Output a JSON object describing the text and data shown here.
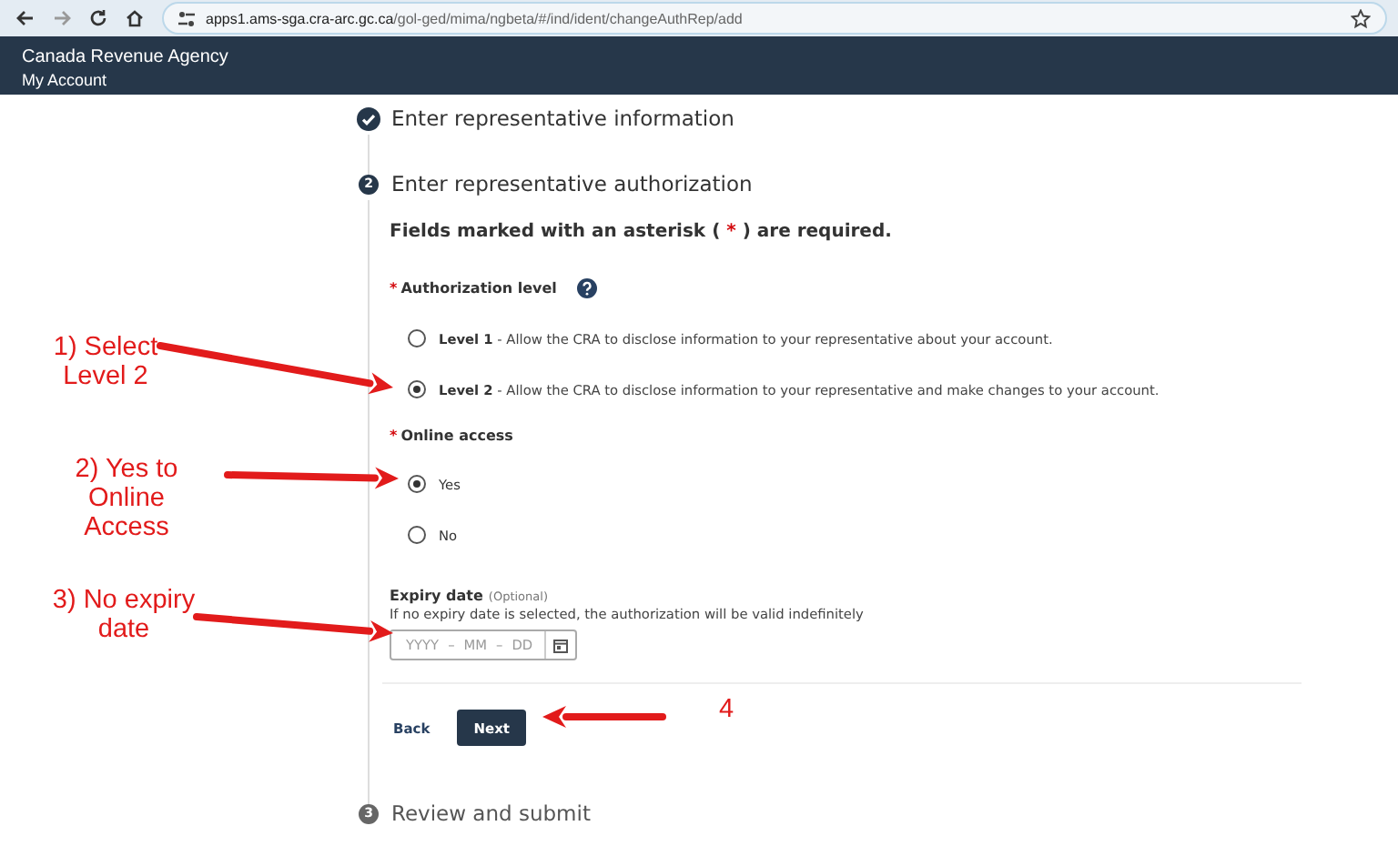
{
  "browser": {
    "url_host": "apps1.ams-sga.cra-arc.gc.ca",
    "url_path": "/gol-ged/mima/ngbeta/#/ind/ident/changeAuthRep/add"
  },
  "header": {
    "title": "Canada Revenue Agency",
    "subtitle": "My Account"
  },
  "steps": [
    {
      "completed": true,
      "current": false,
      "title": "Enter representative information"
    },
    {
      "completed": false,
      "current": true,
      "number": "2",
      "title": "Enter representative authorization"
    },
    {
      "completed": false,
      "current": false,
      "number": "3",
      "title": "Review and submit"
    }
  ],
  "form": {
    "required_note": {
      "before": "Fields marked with an asterisk (",
      "marker": "*",
      "after": ") are required."
    },
    "authorization_level": {
      "label": "Authorization level",
      "required": true,
      "help": true,
      "options": [
        {
          "label": "Level 1",
          "description": "- Allow the CRA to disclose information to your representative about your account.",
          "selected": false
        },
        {
          "label": "Level 2",
          "description": "- Allow the CRA to disclose information to your representative and make changes to your account.",
          "selected": true
        }
      ]
    },
    "online_access": {
      "label": "Online access",
      "required": true,
      "options": [
        {
          "label": "Yes",
          "selected": true
        },
        {
          "label": "No",
          "selected": false
        }
      ]
    },
    "expiry_date": {
      "label": "Expiry date",
      "optional_tag": "(Optional)",
      "hint": "If no expiry date is selected, the authorization will be valid indefinitely",
      "placeholders": [
        "YYYY",
        "MM",
        "DD"
      ],
      "separator": "–"
    },
    "buttons": [
      {
        "kind": "link",
        "label": "Back"
      },
      {
        "kind": "primary",
        "label": "Next"
      }
    ]
  },
  "annotations": [
    {
      "text": "1) Select\nLevel 2"
    },
    {
      "text": "2) Yes to\nOnline\nAccess"
    },
    {
      "text": "3) No expiry\ndate"
    },
    {
      "text": "4"
    }
  ]
}
